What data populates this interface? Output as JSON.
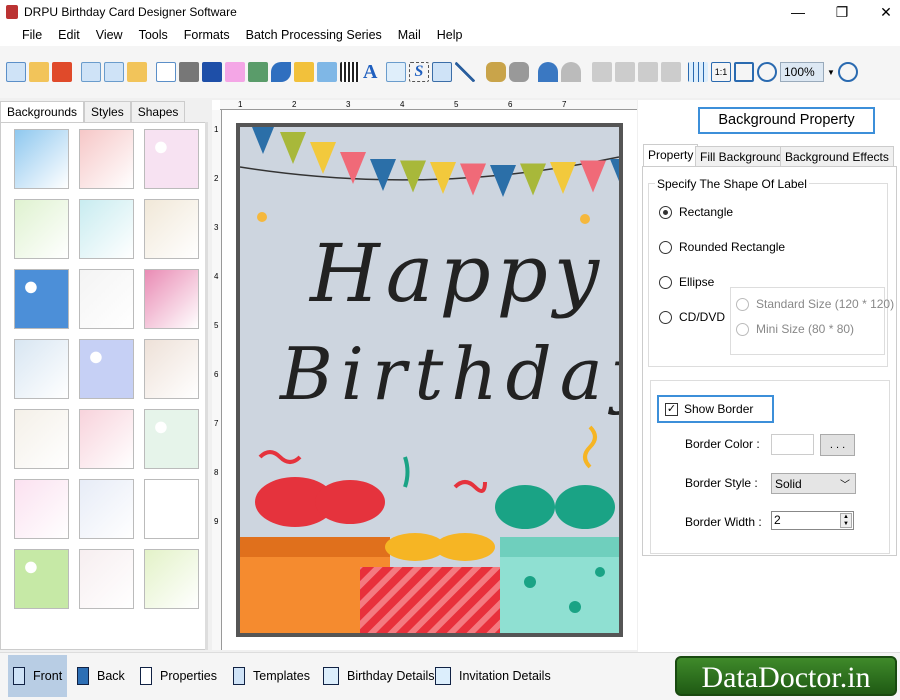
{
  "window": {
    "title": "DRPU Birthday Card Designer Software",
    "minimize": "—",
    "maximize": "❐",
    "close": "✕"
  },
  "menu": [
    "File",
    "Edit",
    "View",
    "Tools",
    "Formats",
    "Batch Processing Series",
    "Mail",
    "Help"
  ],
  "toolbar": {
    "zoom_value": "100%"
  },
  "left_tabs": [
    "Backgrounds",
    "Styles",
    "Shapes"
  ],
  "ruler": {
    "h": [
      "1",
      "2",
      "3",
      "4",
      "5",
      "6",
      "7"
    ],
    "v": [
      "1",
      "2",
      "3",
      "4",
      "5",
      "6",
      "7",
      "8",
      "9"
    ]
  },
  "card": {
    "line1": "Happy",
    "line2": "Birthday"
  },
  "right": {
    "header": "Background Property",
    "tabs": [
      "Property",
      "Fill Background",
      "Background Effects"
    ],
    "shape_group": "Specify The Shape Of Label",
    "shapes": [
      "Rectangle",
      "Rounded Rectangle",
      "Ellipse",
      "CD/DVD"
    ],
    "selected_shape": "Rectangle",
    "cd_sizes": [
      "Standard Size (120 * 120)",
      "Mini Size (80 * 80)"
    ],
    "show_border": "Show Border",
    "show_border_checked": true,
    "border_color_label": "Border Color :",
    "border_color_button": ". . .",
    "border_style_label": "Border Style :",
    "border_style_value": "Solid",
    "border_width_label": "Border Width :",
    "border_width_value": "2"
  },
  "bottom": [
    "Front",
    "Back",
    "Properties",
    "Templates",
    "Birthday Details",
    "Invitation Details"
  ],
  "logo": "DataDoctor.in",
  "colors": {
    "accent": "#3c8fd9",
    "card_bg": "#cdd5df",
    "logo_green": "#2f7a1f"
  }
}
